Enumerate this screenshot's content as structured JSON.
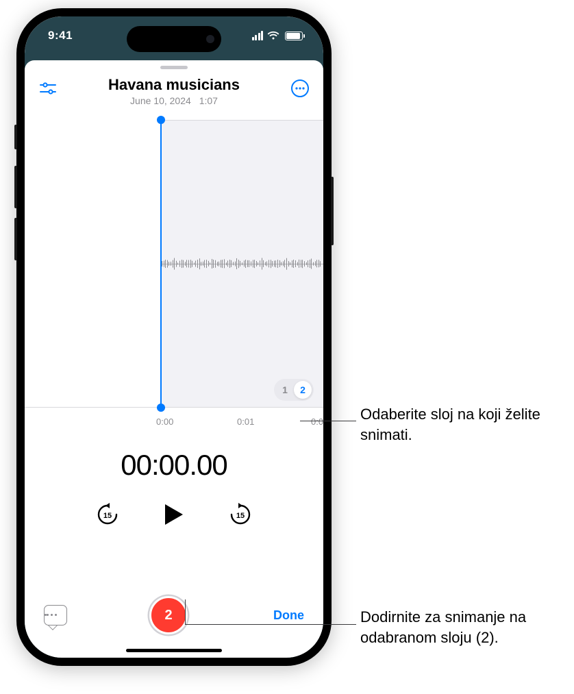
{
  "status": {
    "time": "9:41"
  },
  "header": {
    "title": "Havana musicians",
    "date": "June 10, 2024",
    "duration": "1:07"
  },
  "ruler": {
    "t0": "0:00",
    "t1": "0:01",
    "t2": "0:0"
  },
  "layers": {
    "opt1": "1",
    "opt2": "2",
    "selected": 2
  },
  "timer": "00:00.00",
  "skip": {
    "back_label": "15",
    "fwd_label": "15"
  },
  "record": {
    "layer_badge": "2"
  },
  "done": "Done",
  "callouts": {
    "layers_select": "Odaberite sloj na koji želite snimati.",
    "record_hint": "Dodirnite za snimanje na odabranom sloju (2)."
  }
}
